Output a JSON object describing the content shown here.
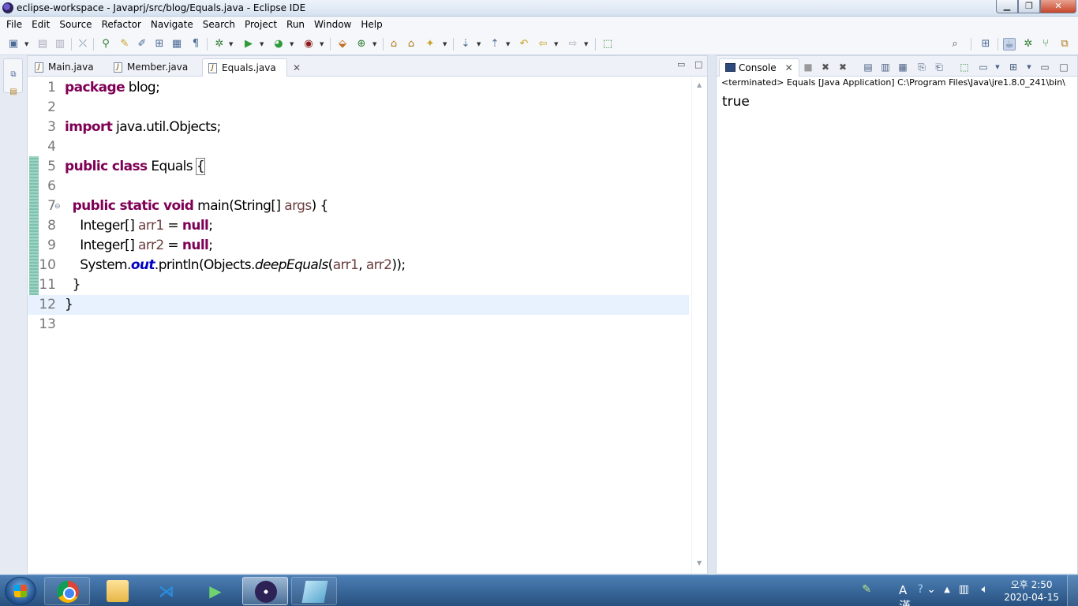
{
  "window": {
    "title": "eclipse-workspace - Javaprj/src/blog/Equals.java - Eclipse IDE",
    "controls": {
      "minimize": "▁",
      "maximize": "❐",
      "close": "✕"
    }
  },
  "menu": [
    "File",
    "Edit",
    "Source",
    "Refactor",
    "Navigate",
    "Search",
    "Project",
    "Run",
    "Window",
    "Help"
  ],
  "editor": {
    "tabs": [
      {
        "label": "Main.java",
        "active": false
      },
      {
        "label": "Member.java",
        "active": false
      },
      {
        "label": "Equals.java",
        "active": true
      }
    ],
    "current_line": 12,
    "lines": [
      {
        "num": "1"
      },
      {
        "num": "2"
      },
      {
        "num": "3"
      },
      {
        "num": "4"
      },
      {
        "num": "5"
      },
      {
        "num": "6"
      },
      {
        "num": "7"
      },
      {
        "num": "8"
      },
      {
        "num": "9"
      },
      {
        "num": "10"
      },
      {
        "num": "11"
      },
      {
        "num": "12"
      },
      {
        "num": "13"
      }
    ],
    "code": {
      "l1_kw": "package",
      "l1_rest": " blog;",
      "l3_kw": "import",
      "l3_rest": " java.util.Objects;",
      "l5_kw": "public class",
      "l5_rest": " Equals ",
      "l5_brace": "{",
      "l7_indent": "  ",
      "l7_kw": "public static void",
      "l7_a": " main(String[] ",
      "l7_var": "args",
      "l7_b": ") {",
      "l8_a": "    Integer[] ",
      "l8_var": "arr1",
      "l8_b": " = ",
      "l8_kw": "null",
      "l8_c": ";",
      "l9_a": "    Integer[] ",
      "l9_var": "arr2",
      "l9_b": " = ",
      "l9_kw": "null",
      "l9_c": ";",
      "l10_a": "    System.",
      "l10_fld": "out",
      "l10_b": ".println(Objects.",
      "l10_it": "deepEquals",
      "l10_c": "(",
      "l10_v1": "arr1",
      "l10_d": ", ",
      "l10_v2": "arr2",
      "l10_e": "));",
      "l11": "  }",
      "l12": "}"
    }
  },
  "console": {
    "tab_label": "Console",
    "terminated": "<terminated> Equals [Java Application] C:\\Program Files\\Java\\jre1.8.0_241\\bin\\",
    "output": "true"
  },
  "taskbar": {
    "apps": [
      {
        "name": "chrome-icon"
      },
      {
        "name": "file-explorer-icon"
      },
      {
        "name": "vscode-icon"
      },
      {
        "name": "media-app-icon"
      },
      {
        "name": "eclipse-icon"
      },
      {
        "name": "notepad-icon"
      }
    ],
    "clock_time": "오후 2:50",
    "clock_date": "2020-04-15",
    "ime_label": "A 漢"
  },
  "colors": {
    "keyword": "#7f0055",
    "variable": "#6a3e3e",
    "static_field": "#0000c0",
    "current_line": "#e8f2fe",
    "taskbar": "#27507f"
  }
}
